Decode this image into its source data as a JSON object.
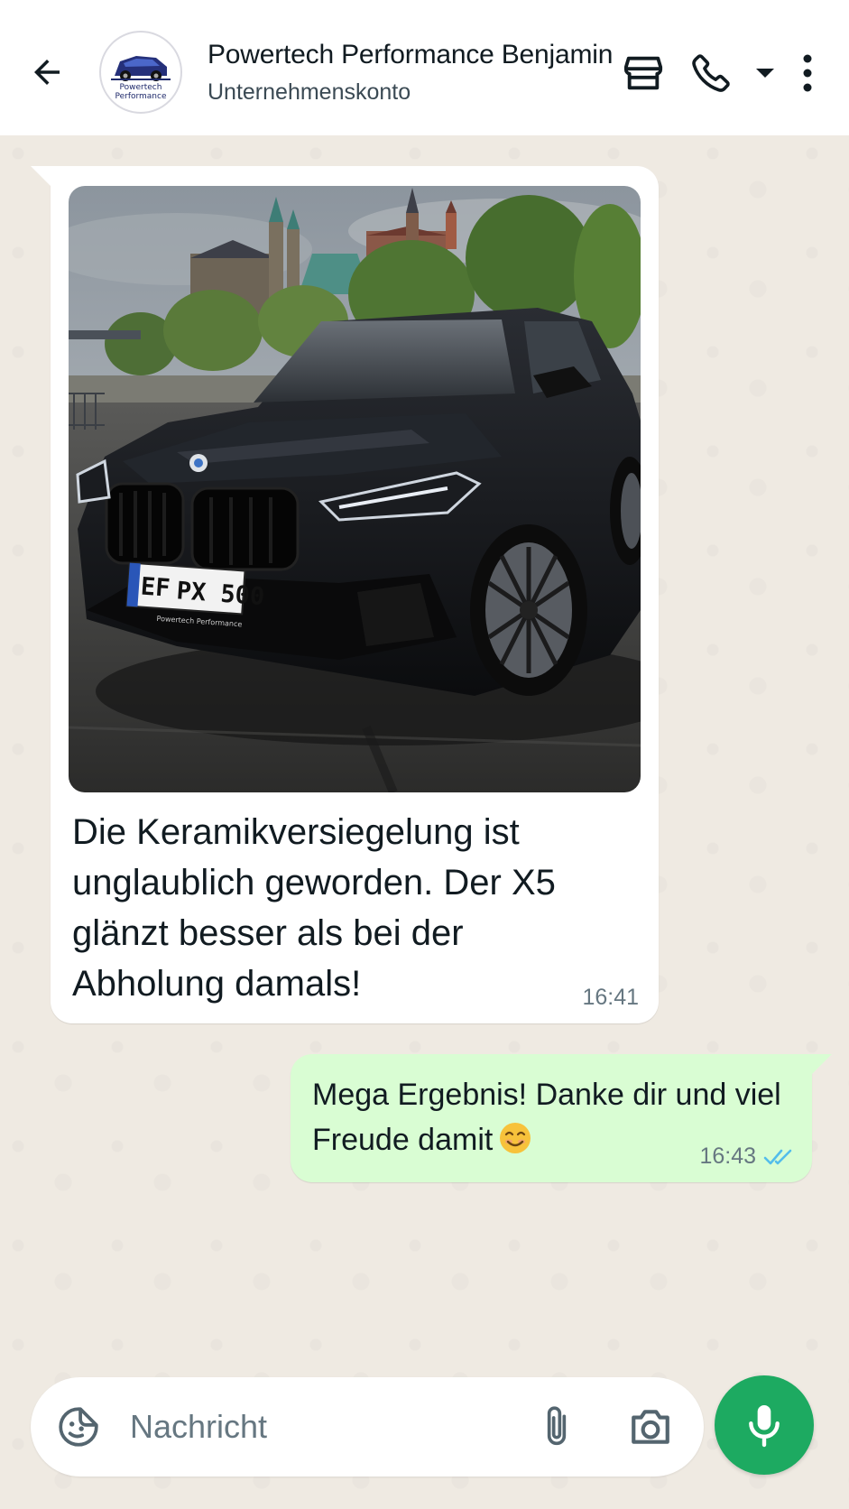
{
  "header": {
    "contact_name": "Powertech Performance Benjamin",
    "contact_subtitle": "Unternehmenskonto",
    "avatar_text_line1": "Powertech",
    "avatar_text_line2": "Performance",
    "icons": [
      "back-arrow-icon",
      "store-icon",
      "phone-icon",
      "chevron-down-icon",
      "more-vertical-icon"
    ]
  },
  "messages": [
    {
      "direction": "incoming",
      "image": {
        "subject": "black-suv-photo",
        "plate_left": "EF",
        "plate_right": "PX 500",
        "plate_dealer": "Powertech Performance"
      },
      "text": "Die Keramikversiegelung ist unglaublich geworden. Der X5 glänzt besser als bei der Abholung damals!",
      "time": "16:41"
    },
    {
      "direction": "outgoing",
      "text": "Mega Ergebnis! Danke dir und viel Freude damit",
      "emoji": "smiling-face-icon",
      "time": "16:43",
      "status": "read",
      "status_color": "#53bdeb"
    }
  ],
  "composer": {
    "placeholder": "Nachricht",
    "icons": [
      "sticker-icon",
      "paperclip-icon",
      "camera-icon",
      "microphone-icon"
    ]
  },
  "colors": {
    "accent": "#1daa61",
    "incoming_bubble": "#ffffff",
    "outgoing_bubble": "#d9fdd3",
    "chat_background": "#efeae2"
  }
}
